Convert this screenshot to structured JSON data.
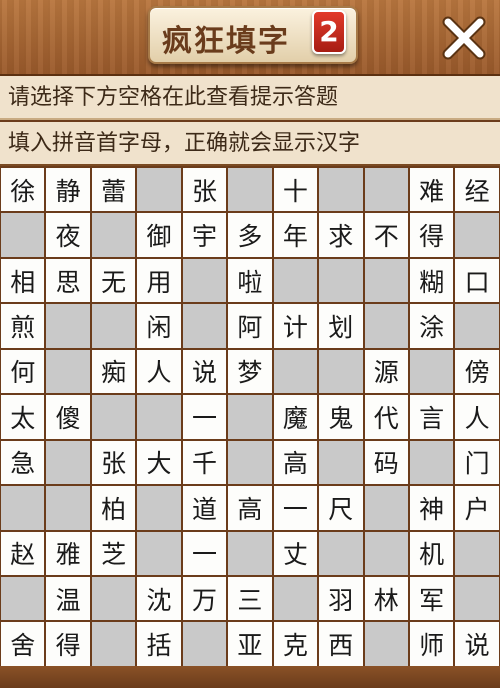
{
  "header": {
    "title": "疯狂填字",
    "badge": "2",
    "close_icon": "close-x-icon"
  },
  "hints": {
    "line1": "请选择下方空格在此查看提示答题",
    "line2": "填入拼音首字母，正确就会显示汉字"
  },
  "board": {
    "rows": [
      [
        "徐",
        "静",
        "蕾",
        "",
        "张",
        "",
        "十",
        "",
        "",
        "难",
        "经"
      ],
      [
        "",
        "夜",
        "",
        "御",
        "宇",
        "多",
        "年",
        "求",
        "不",
        "得",
        ""
      ],
      [
        "相",
        "思",
        "无",
        "用",
        "",
        "啦",
        "",
        "",
        "",
        "糊",
        "口"
      ],
      [
        "煎",
        "",
        "",
        "闲",
        "",
        "阿",
        "计",
        "划",
        "",
        "涂",
        ""
      ],
      [
        "何",
        "",
        "痴",
        "人",
        "说",
        "梦",
        "",
        "",
        "源",
        "",
        "傍"
      ],
      [
        "太",
        "傻",
        "",
        "",
        "一",
        "",
        "魔",
        "鬼",
        "代",
        "言",
        "人"
      ],
      [
        "急",
        "",
        "张",
        "大",
        "千",
        "",
        "高",
        "",
        "码",
        "",
        "门"
      ],
      [
        "",
        "",
        "柏",
        "",
        "道",
        "高",
        "一",
        "尺",
        "",
        "神",
        "户"
      ],
      [
        "赵",
        "雅",
        "芝",
        "",
        "一",
        "",
        "丈",
        "",
        "",
        "机",
        ""
      ],
      [
        "",
        "温",
        "",
        "沈",
        "万",
        "三",
        "",
        "羽",
        "林",
        "军",
        ""
      ],
      [
        "舍",
        "得",
        "",
        "括",
        "",
        "亚",
        "克",
        "西",
        "",
        "师",
        "说"
      ]
    ],
    "cell_types": [
      [
        "f",
        "f",
        "f",
        "b",
        "f",
        "b",
        "f",
        "b",
        "b",
        "f",
        "f"
      ],
      [
        "b",
        "f",
        "b",
        "f",
        "f",
        "f",
        "f",
        "f",
        "f",
        "f",
        "b"
      ],
      [
        "f",
        "f",
        "f",
        "f",
        "b",
        "f",
        "b",
        "b",
        "b",
        "f",
        "f"
      ],
      [
        "f",
        "b",
        "b",
        "f",
        "b",
        "f",
        "f",
        "f",
        "b",
        "f",
        "b"
      ],
      [
        "f",
        "b",
        "f",
        "f",
        "f",
        "f",
        "b",
        "b",
        "f",
        "b",
        "f"
      ],
      [
        "f",
        "f",
        "b",
        "b",
        "f",
        "b",
        "f",
        "f",
        "f",
        "f",
        "f"
      ],
      [
        "f",
        "b",
        "f",
        "f",
        "f",
        "b",
        "f",
        "b",
        "f",
        "b",
        "f"
      ],
      [
        "b",
        "b",
        "f",
        "b",
        "f",
        "f",
        "f",
        "f",
        "b",
        "f",
        "f"
      ],
      [
        "f",
        "f",
        "f",
        "b",
        "f",
        "b",
        "f",
        "b",
        "b",
        "f",
        "b"
      ],
      [
        "b",
        "f",
        "b",
        "f",
        "f",
        "f",
        "b",
        "f",
        "f",
        "f",
        "b"
      ],
      [
        "f",
        "f",
        "b",
        "f",
        "b",
        "f",
        "f",
        "f",
        "b",
        "f",
        "f"
      ]
    ]
  },
  "colors": {
    "wood": "#9a5a2b",
    "grid_line": "#6b3c1b",
    "blank_cell": "#c9c9c9",
    "filled_cell": "#fdfdfb",
    "hint_bg": "#f0e2cc",
    "badge": "#d12a1e"
  }
}
